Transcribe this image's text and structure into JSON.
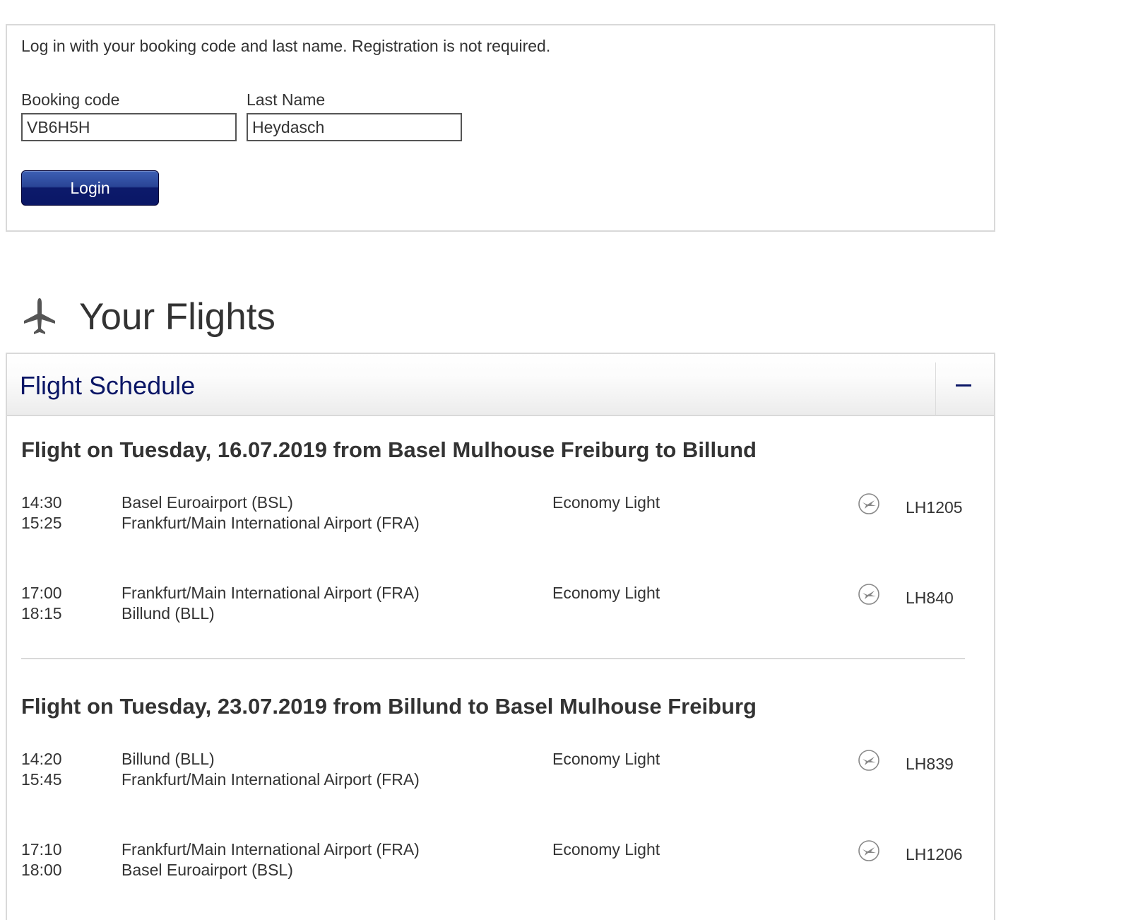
{
  "login": {
    "intro": "Log in with your booking code and last name. Registration is not required.",
    "booking_code_label": "Booking code",
    "booking_code_value": "VB6H5H",
    "last_name_label": "Last Name",
    "last_name_value": "Heydasch",
    "login_button": "Login"
  },
  "flights": {
    "heading": "Your Flights",
    "icon": "airplane-icon"
  },
  "schedule": {
    "title": "Flight Schedule",
    "collapse_icon": "minus-icon",
    "trips": [
      {
        "title": "Flight on Tuesday, 16.07.2019 from Basel Mulhouse Freiburg to Billund",
        "segments": [
          {
            "departure_time": "14:30",
            "arrival_time": "15:25",
            "from": "Basel Euroairport (BSL)",
            "to": "Frankfurt/Main International Airport (FRA)",
            "fare_class": "Economy Light",
            "airline_icon": "lufthansa-crane-icon",
            "flight_number": "LH1205"
          },
          {
            "departure_time": "17:00",
            "arrival_time": "18:15",
            "from": "Frankfurt/Main International Airport (FRA)",
            "to": "Billund (BLL)",
            "fare_class": "Economy Light",
            "airline_icon": "lufthansa-crane-icon",
            "flight_number": "LH840"
          }
        ]
      },
      {
        "title": "Flight on Tuesday, 23.07.2019 from Billund to Basel Mulhouse Freiburg",
        "segments": [
          {
            "departure_time": "14:20",
            "arrival_time": "15:45",
            "from": "Billund (BLL)",
            "to": "Frankfurt/Main International Airport (FRA)",
            "fare_class": "Economy Light",
            "airline_icon": "lufthansa-crane-icon",
            "flight_number": "LH839"
          },
          {
            "departure_time": "17:10",
            "arrival_time": "18:00",
            "from": "Frankfurt/Main International Airport (FRA)",
            "to": "Basel Euroairport (BSL)",
            "fare_class": "Economy Light",
            "airline_icon": "lufthansa-crane-icon",
            "flight_number": "LH1206"
          }
        ]
      }
    ]
  },
  "colors": {
    "brand_navy": "#0a1666",
    "text": "#333333",
    "border": "#d9d9d9"
  }
}
